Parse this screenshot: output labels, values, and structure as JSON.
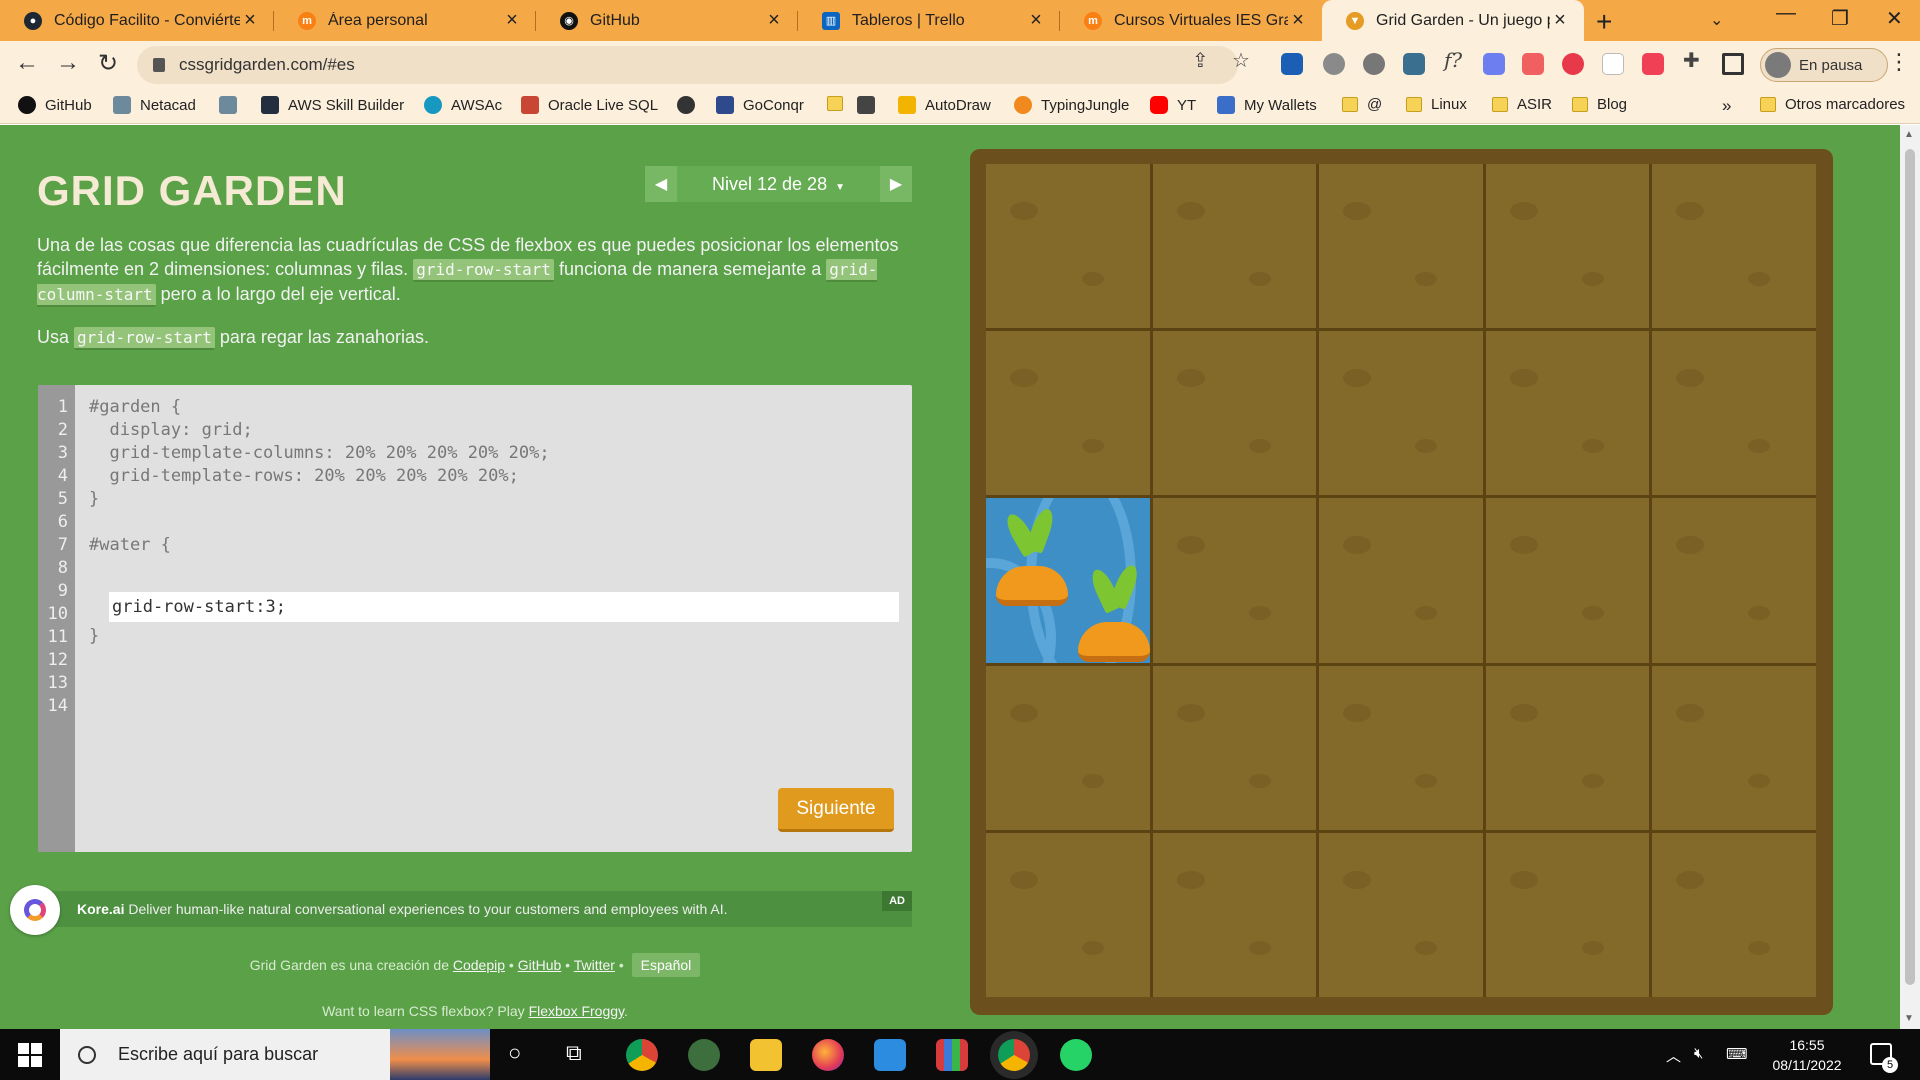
{
  "browser": {
    "tabs": [
      {
        "title": "Código Facilito - Conviértet",
        "favicon": "codigo-facilito-icon",
        "color": "#1f2733"
      },
      {
        "title": "Área personal",
        "favicon": "moodle-icon",
        "color": "#f98012"
      },
      {
        "title": "GitHub",
        "favicon": "github-icon",
        "color": "#111111"
      },
      {
        "title": "Tableros | Trello",
        "favicon": "trello-icon",
        "color": "#0a66c2"
      },
      {
        "title": "Cursos Virtuales IES Gran C",
        "favicon": "moodle-icon",
        "color": "#f98012"
      },
      {
        "title": "Grid Garden - Un juego par",
        "favicon": "carrot-icon",
        "color": "#e69b23"
      }
    ],
    "url": "cssgridgarden.com/#es",
    "profile_label": "En pausa",
    "bookmarks": [
      {
        "label": "GitHub",
        "icon": "github-icon"
      },
      {
        "label": "Netacad",
        "icon": "cisco-icon"
      },
      {
        "label": "",
        "icon": "cisco-icon"
      },
      {
        "label": "AWS Skill Builder",
        "icon": "aws-icon"
      },
      {
        "label": "AWSAc",
        "icon": "salesforce-icon"
      },
      {
        "label": "Oracle Live SQL",
        "icon": "oracle-icon"
      },
      {
        "label": "",
        "icon": "globe-icon"
      },
      {
        "label": "GoConqr",
        "icon": "goconqr-icon"
      },
      {
        "label": "",
        "icon": "folder-icon"
      },
      {
        "label": "",
        "icon": "tools-icon"
      },
      {
        "label": "AutoDraw",
        "icon": "autodraw-icon"
      },
      {
        "label": "TypingJungle",
        "icon": "typingjungle-icon"
      },
      {
        "label": "YT",
        "icon": "youtube-icon"
      },
      {
        "label": "My Wallets",
        "icon": "wallet-icon"
      },
      {
        "label": "@",
        "icon": "folder-icon"
      },
      {
        "label": "Linux",
        "icon": "folder-icon"
      },
      {
        "label": "ASIR",
        "icon": "folder-icon"
      },
      {
        "label": "Blog",
        "icon": "folder-icon"
      }
    ],
    "bookmarks_overflow": "»",
    "other_bookmarks": "Otros marcadores"
  },
  "game": {
    "title": "GRID GARDEN",
    "level_label": "Nivel 12 de 28",
    "instruction_p1_a": "Una de las cosas que diferencia las cuadrículas de CSS de flexbox es que puedes posicionar los elementos fácilmente en 2 dimensiones: columnas y filas. ",
    "instruction_p1_code1": "grid-row-start",
    "instruction_p1_b": " funciona de manera semejante a ",
    "instruction_p1_code2": "grid-column-start",
    "instruction_p1_c": " pero a lo largo del eje vertical.",
    "instruction_p2_a": "Usa ",
    "instruction_p2_code": "grid-row-start",
    "instruction_p2_b": " para regar las zanahorias.",
    "line_numbers": [
      "1",
      "2",
      "3",
      "4",
      "5",
      "6",
      "7",
      "8",
      "9",
      "10",
      "11",
      "12",
      "13",
      "14"
    ],
    "code_lines": [
      "#garden {",
      "  display: grid;",
      "  grid-template-columns: 20% 20% 20% 20% 20%;",
      "  grid-template-rows: 20% 20% 20% 20% 20%;",
      "}",
      "",
      "#water {",
      "",
      "}"
    ],
    "answer_value": "grid-row-start:3;",
    "next_button": "Siguiente",
    "garden": {
      "columns": 5,
      "rows": 5,
      "water_row": 3,
      "water_col": 1
    },
    "colors": {
      "background": "#5aa148",
      "soil": "#846a2a",
      "water": "#3e8fc6",
      "carrot": "#f0991c"
    }
  },
  "ad": {
    "brand": "Kore.ai",
    "text": " Deliver human-like natural conversational experiences to your customers and employees with AI.",
    "badge": "AD"
  },
  "footer": {
    "prefix": "Grid Garden es una creación de ",
    "codepip": "Codepip",
    "sep1": " • ",
    "github": "GitHub",
    "sep2": " • ",
    "twitter": "Twitter",
    "sep3": " • ",
    "language": "Español",
    "froggy_prefix": "Want to learn CSS flexbox? Play ",
    "froggy_link": "Flexbox Froggy",
    "froggy_suffix": "."
  },
  "taskbar": {
    "search_placeholder": "Escribe aquí para buscar",
    "time": "16:55",
    "date": "08/11/2022",
    "notifications": "5"
  }
}
